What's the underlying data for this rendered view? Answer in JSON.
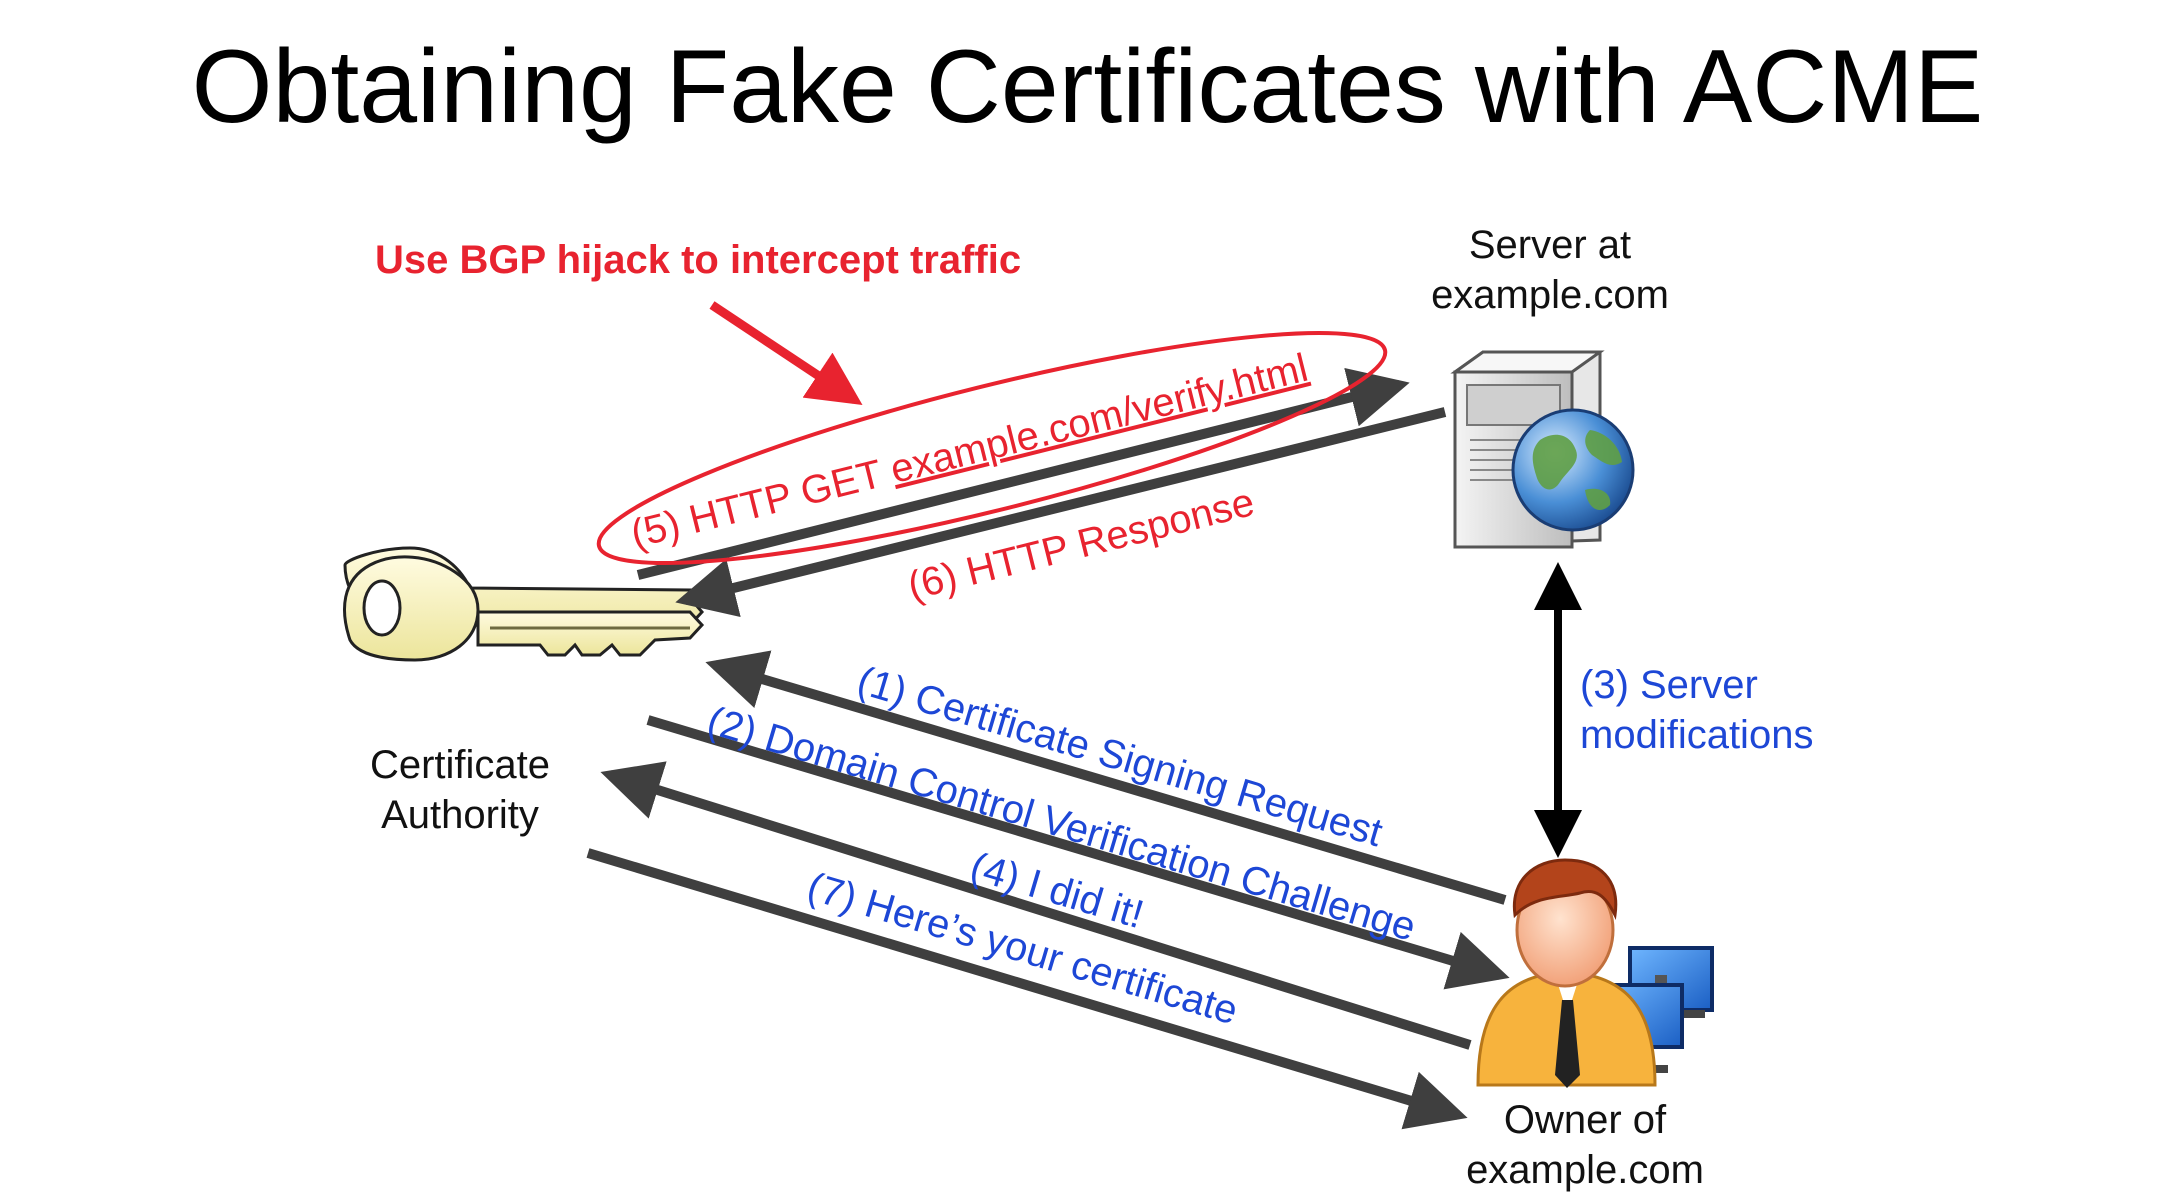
{
  "title": "Obtaining Fake Certificates with ACME",
  "annotation": "Use BGP hijack to intercept traffic",
  "nodes": {
    "ca": {
      "line1": "Certificate",
      "line2": "Authority",
      "icon": "key-icon"
    },
    "server": {
      "line1": "Server at",
      "line2": "example.com",
      "icon": "server-globe-icon"
    },
    "owner": {
      "line1": "Owner of",
      "line2": "example.com",
      "icon": "person-computer-icon"
    }
  },
  "steps": {
    "s1": "(1) Certificate Signing Request",
    "s2": "(2) Domain Control Verification Challenge",
    "s3_line1": "(3) Server",
    "s3_line2": "modifications",
    "s4": "(4) I did it!",
    "s5_prefix": "(5) HTTP GET ",
    "s5_link": "example.com/verify.html",
    "s6": "(6) HTTP Response",
    "s7": "(7) Here’s your certificate"
  },
  "colors": {
    "step_blue": "#1d47d6",
    "http_red": "#e8232f",
    "arrow_gray": "#3f3f3f",
    "highlight_red": "#e8232f"
  }
}
